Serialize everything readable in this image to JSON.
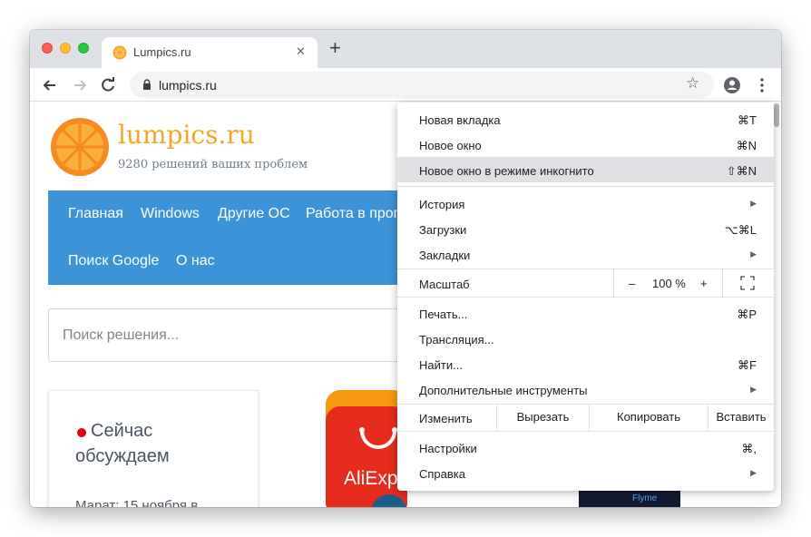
{
  "tab": {
    "title": "Lumpics.ru",
    "close_icon": "close-icon",
    "favicon": "orange-icon"
  },
  "new_tab_icon": "plus-icon",
  "toolbar": {
    "back_icon": "back-arrow-icon",
    "forward_icon": "forward-arrow-icon",
    "reload_icon": "reload-icon",
    "url": "lumpics.ru",
    "star_icon": "star-icon",
    "profile_icon": "profile-icon",
    "menu_icon": "three-dot-menu-icon"
  },
  "site": {
    "name": "lumpics.ru",
    "tagline": "9280 решений ваших проблем",
    "nav": [
      "Главная",
      "Windows",
      "Другие ОС",
      "Работа в прог",
      "Поиск Google",
      "О нас"
    ],
    "search_placeholder": "Поиск решения...",
    "discussion": {
      "line1": "Сейчас",
      "line2": "обсуждаем",
      "meta": "Марат: 15 ноября в"
    },
    "ali_text": "AliExp",
    "flyme_text": "Flyme"
  },
  "menu": {
    "items": [
      {
        "label": "Новая вкладка",
        "shortcut": "⌘T"
      },
      {
        "label": "Новое окно",
        "shortcut": "⌘N"
      },
      {
        "label": "Новое окно в режиме инкогнито",
        "shortcut": "⇧⌘N"
      },
      {
        "label": "История",
        "shortcut": ""
      },
      {
        "label": "Загрузки",
        "shortcut": "⌥⌘L"
      },
      {
        "label": "Закладки",
        "shortcut": ""
      },
      {
        "label": "Печать...",
        "shortcut": "⌘P"
      },
      {
        "label": "Трансляция...",
        "shortcut": ""
      },
      {
        "label": "Найти...",
        "shortcut": "⌘F"
      },
      {
        "label": "Дополнительные инструменты",
        "shortcut": ""
      },
      {
        "label": "Настройки",
        "shortcut": "⌘,"
      },
      {
        "label": "Справка",
        "shortcut": ""
      }
    ],
    "zoom": {
      "label": "Масштаб",
      "minus": "–",
      "value": "100 %",
      "plus": "+"
    },
    "edit": {
      "label": "Изменить",
      "cut": "Вырезать",
      "copy": "Копировать",
      "paste": "Вставить"
    },
    "highlighted": "Новое окно в режиме инкогнито"
  },
  "colors": {
    "accent_blue": "#3d93d8",
    "brand_orange": "#f5a623",
    "highlight": "#dfe1e5"
  }
}
